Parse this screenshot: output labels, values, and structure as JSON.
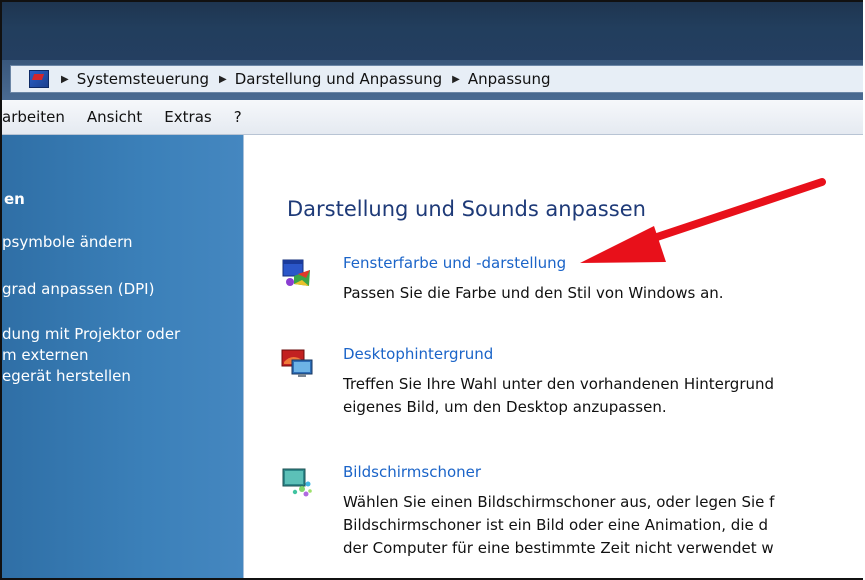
{
  "breadcrumb": {
    "items": [
      "Systemsteuerung",
      "Darstellung und Anpassung",
      "Anpassung"
    ]
  },
  "menu": {
    "items": [
      "arbeiten",
      "Ansicht",
      "Extras",
      "?"
    ]
  },
  "sidebar": {
    "title": "en",
    "links": [
      "psymbole ändern",
      "grad anpassen (DPI)",
      "dung mit Projektor oder\nm externen\negerät herstellen"
    ]
  },
  "main": {
    "title": "Darstellung und Sounds anpassen",
    "tasks": [
      {
        "icon": "window-color-icon",
        "link": "Fensterfarbe und -darstellung",
        "description": "Passen Sie die Farbe und den Stil von Windows an."
      },
      {
        "icon": "desktop-background-icon",
        "link": "Desktophintergrund",
        "description": "Treffen Sie Ihre Wahl unter den vorhandenen Hintergrund\neigenes Bild, um den Desktop anzupassen."
      },
      {
        "icon": "screensaver-icon",
        "link": "Bildschirmschoner",
        "description": "Wählen Sie einen Bildschirmschoner aus, oder legen Sie f\nBildschirmschoner ist ein Bild oder eine Animation, die d\nder Computer für eine bestimmte Zeit nicht verwendet w"
      }
    ]
  },
  "colors": {
    "link": "#1b64c8",
    "title": "#1e3a78",
    "sidebar": "#3b80b9",
    "arrow": "#e8101a"
  }
}
